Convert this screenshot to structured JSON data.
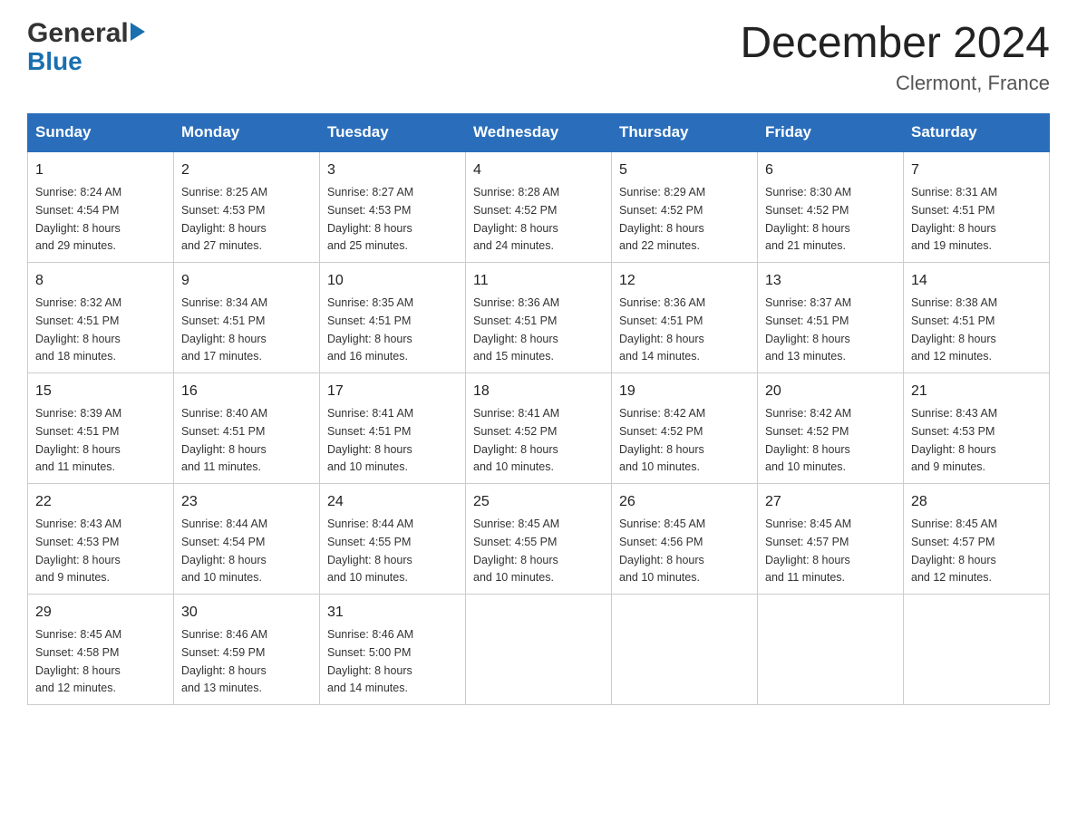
{
  "logo": {
    "line1": "General",
    "line2": "Blue"
  },
  "title": {
    "month_year": "December 2024",
    "location": "Clermont, France"
  },
  "days_of_week": [
    "Sunday",
    "Monday",
    "Tuesday",
    "Wednesday",
    "Thursday",
    "Friday",
    "Saturday"
  ],
  "weeks": [
    [
      {
        "day": "1",
        "sunrise": "8:24 AM",
        "sunset": "4:54 PM",
        "daylight": "8 hours and 29 minutes."
      },
      {
        "day": "2",
        "sunrise": "8:25 AM",
        "sunset": "4:53 PM",
        "daylight": "8 hours and 27 minutes."
      },
      {
        "day": "3",
        "sunrise": "8:27 AM",
        "sunset": "4:53 PM",
        "daylight": "8 hours and 25 minutes."
      },
      {
        "day": "4",
        "sunrise": "8:28 AM",
        "sunset": "4:52 PM",
        "daylight": "8 hours and 24 minutes."
      },
      {
        "day": "5",
        "sunrise": "8:29 AM",
        "sunset": "4:52 PM",
        "daylight": "8 hours and 22 minutes."
      },
      {
        "day": "6",
        "sunrise": "8:30 AM",
        "sunset": "4:52 PM",
        "daylight": "8 hours and 21 minutes."
      },
      {
        "day": "7",
        "sunrise": "8:31 AM",
        "sunset": "4:51 PM",
        "daylight": "8 hours and 19 minutes."
      }
    ],
    [
      {
        "day": "8",
        "sunrise": "8:32 AM",
        "sunset": "4:51 PM",
        "daylight": "8 hours and 18 minutes."
      },
      {
        "day": "9",
        "sunrise": "8:34 AM",
        "sunset": "4:51 PM",
        "daylight": "8 hours and 17 minutes."
      },
      {
        "day": "10",
        "sunrise": "8:35 AM",
        "sunset": "4:51 PM",
        "daylight": "8 hours and 16 minutes."
      },
      {
        "day": "11",
        "sunrise": "8:36 AM",
        "sunset": "4:51 PM",
        "daylight": "8 hours and 15 minutes."
      },
      {
        "day": "12",
        "sunrise": "8:36 AM",
        "sunset": "4:51 PM",
        "daylight": "8 hours and 14 minutes."
      },
      {
        "day": "13",
        "sunrise": "8:37 AM",
        "sunset": "4:51 PM",
        "daylight": "8 hours and 13 minutes."
      },
      {
        "day": "14",
        "sunrise": "8:38 AM",
        "sunset": "4:51 PM",
        "daylight": "8 hours and 12 minutes."
      }
    ],
    [
      {
        "day": "15",
        "sunrise": "8:39 AM",
        "sunset": "4:51 PM",
        "daylight": "8 hours and 11 minutes."
      },
      {
        "day": "16",
        "sunrise": "8:40 AM",
        "sunset": "4:51 PM",
        "daylight": "8 hours and 11 minutes."
      },
      {
        "day": "17",
        "sunrise": "8:41 AM",
        "sunset": "4:51 PM",
        "daylight": "8 hours and 10 minutes."
      },
      {
        "day": "18",
        "sunrise": "8:41 AM",
        "sunset": "4:52 PM",
        "daylight": "8 hours and 10 minutes."
      },
      {
        "day": "19",
        "sunrise": "8:42 AM",
        "sunset": "4:52 PM",
        "daylight": "8 hours and 10 minutes."
      },
      {
        "day": "20",
        "sunrise": "8:42 AM",
        "sunset": "4:52 PM",
        "daylight": "8 hours and 10 minutes."
      },
      {
        "day": "21",
        "sunrise": "8:43 AM",
        "sunset": "4:53 PM",
        "daylight": "8 hours and 9 minutes."
      }
    ],
    [
      {
        "day": "22",
        "sunrise": "8:43 AM",
        "sunset": "4:53 PM",
        "daylight": "8 hours and 9 minutes."
      },
      {
        "day": "23",
        "sunrise": "8:44 AM",
        "sunset": "4:54 PM",
        "daylight": "8 hours and 10 minutes."
      },
      {
        "day": "24",
        "sunrise": "8:44 AM",
        "sunset": "4:55 PM",
        "daylight": "8 hours and 10 minutes."
      },
      {
        "day": "25",
        "sunrise": "8:45 AM",
        "sunset": "4:55 PM",
        "daylight": "8 hours and 10 minutes."
      },
      {
        "day": "26",
        "sunrise": "8:45 AM",
        "sunset": "4:56 PM",
        "daylight": "8 hours and 10 minutes."
      },
      {
        "day": "27",
        "sunrise": "8:45 AM",
        "sunset": "4:57 PM",
        "daylight": "8 hours and 11 minutes."
      },
      {
        "day": "28",
        "sunrise": "8:45 AM",
        "sunset": "4:57 PM",
        "daylight": "8 hours and 12 minutes."
      }
    ],
    [
      {
        "day": "29",
        "sunrise": "8:45 AM",
        "sunset": "4:58 PM",
        "daylight": "8 hours and 12 minutes."
      },
      {
        "day": "30",
        "sunrise": "8:46 AM",
        "sunset": "4:59 PM",
        "daylight": "8 hours and 13 minutes."
      },
      {
        "day": "31",
        "sunrise": "8:46 AM",
        "sunset": "5:00 PM",
        "daylight": "8 hours and 14 minutes."
      },
      null,
      null,
      null,
      null
    ]
  ],
  "labels": {
    "sunrise": "Sunrise:",
    "sunset": "Sunset:",
    "daylight": "Daylight:"
  }
}
